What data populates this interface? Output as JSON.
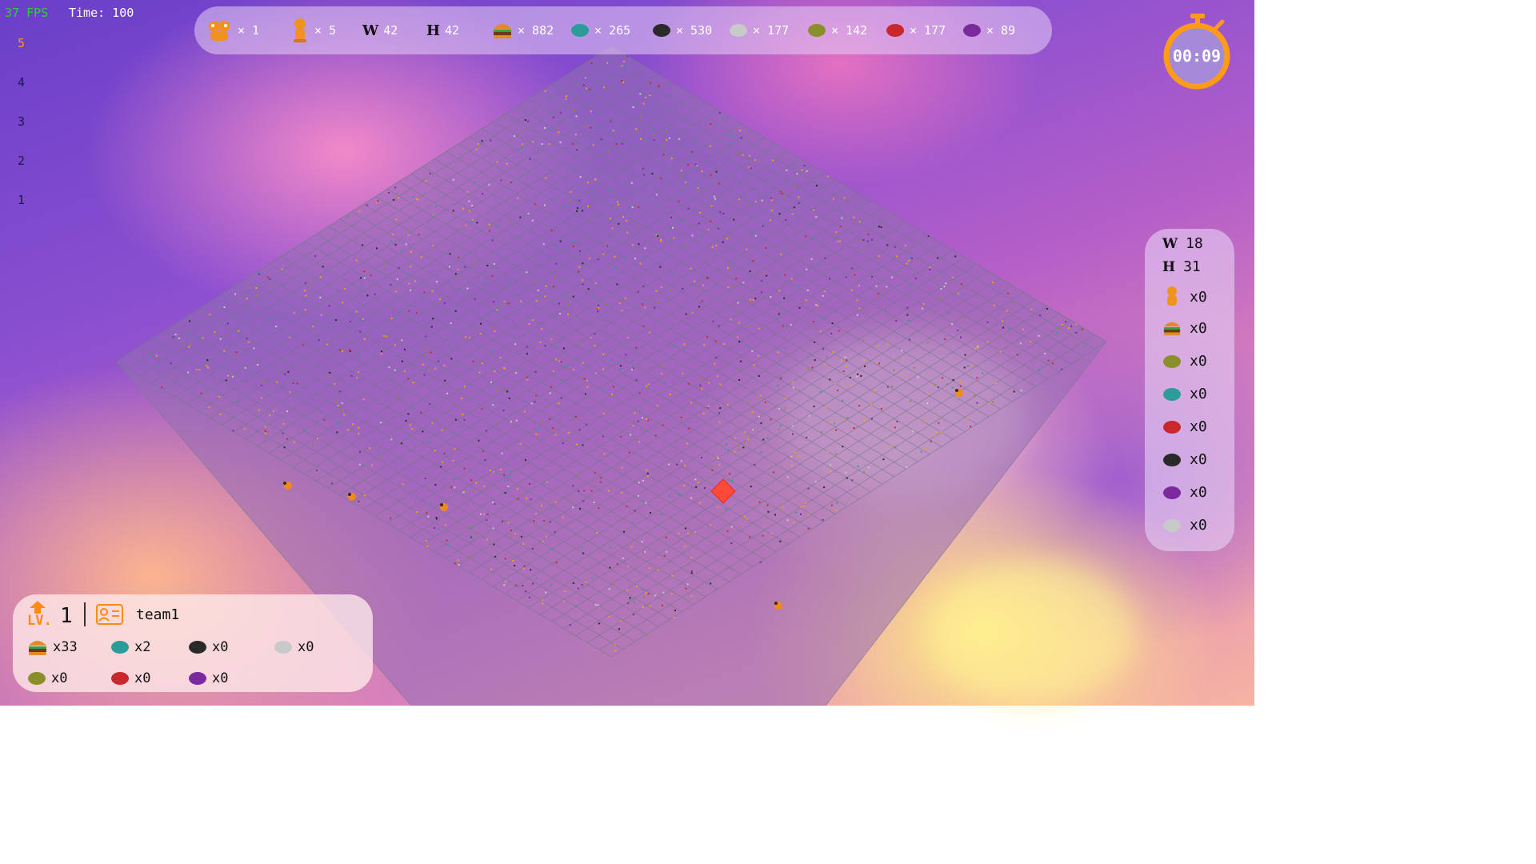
{
  "hud": {
    "fps": "37 FPS",
    "time": "Time: 100"
  },
  "levels": [
    "5",
    "4",
    "3",
    "2",
    "1"
  ],
  "active_level": "5",
  "topbar": {
    "team_count": "× 1",
    "player_count": "× 5",
    "width_label": "W",
    "width_value": "42",
    "height_label": "H",
    "height_value": "42",
    "food": "× 882",
    "linemate": "× 265",
    "deraumere": "× 530",
    "sibur": "× 177",
    "mendiane": "× 142",
    "phiras": "× 177",
    "thystame": "× 89"
  },
  "timer": {
    "value": "00:09"
  },
  "right_panel": {
    "w_label": "W",
    "w_value": "18",
    "h_label": "H",
    "h_value": "31",
    "player": "x0",
    "food": "x0",
    "olive_stone": "x0",
    "teal_stone": "x0",
    "red_stone": "x0",
    "black_stone": "x0",
    "purple_stone": "x0",
    "gray_stone": "x0"
  },
  "player_panel": {
    "level_label": "LV.",
    "level": "1",
    "team": "team1",
    "food": "x33",
    "teal_stone": "x2",
    "black_stone": "x0",
    "gray_stone": "x0",
    "olive_stone": "x0",
    "red_stone": "x0",
    "purple_stone": "x0"
  },
  "colors": {
    "accent": "#ff9a1a",
    "fps_green": "#2ecc40",
    "teal": "#2c9c9a",
    "black": "#2a2a2a",
    "gray": "#c9c9c9",
    "olive": "#8a8f2c",
    "red": "#c8282c",
    "purple": "#7a2a9c",
    "selected_tile": "#ff4a3a"
  },
  "icons": {
    "team": "garfield-pair-icon",
    "player": "garfield-icon",
    "food": "burger-icon",
    "stone": "stone-icon",
    "timer": "stopwatch-icon",
    "team_card": "id-card-icon",
    "level_up": "arrow-up-icon"
  }
}
